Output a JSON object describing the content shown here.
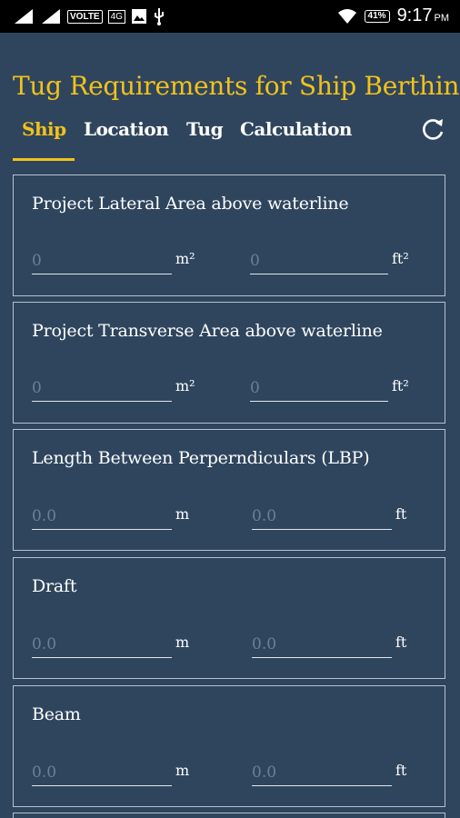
{
  "status_bar": {
    "volte": "VOLTE",
    "network": "4G",
    "battery": "41%",
    "time": "9:17",
    "ampm": "PM"
  },
  "app": {
    "title": "Tug Requirements for Ship Berthing"
  },
  "tabs": [
    {
      "label": "Ship",
      "active": true
    },
    {
      "label": "Location"
    },
    {
      "label": "Tug"
    },
    {
      "label": "Calculation"
    }
  ],
  "cards": [
    {
      "title": "Project Lateral Area above waterline",
      "left_placeholder": "0",
      "left_unit": "m²",
      "right_placeholder": "0",
      "right_unit": "ft²"
    },
    {
      "title": "Project Transverse Area above waterline",
      "left_placeholder": "0",
      "left_unit": "m²",
      "right_placeholder": "0",
      "right_unit": "ft²"
    },
    {
      "title": "Length Between Perperndiculars (LBP)",
      "left_placeholder": "0.0",
      "left_unit": "m",
      "right_placeholder": "0.0",
      "right_unit": "ft"
    },
    {
      "title": "Draft",
      "left_placeholder": "0.0",
      "left_unit": "m",
      "right_placeholder": "0.0",
      "right_unit": "ft"
    },
    {
      "title": "Beam",
      "left_placeholder": "0.0",
      "left_unit": "m",
      "right_placeholder": "0.0",
      "right_unit": "ft"
    }
  ],
  "icons": {
    "refresh": "refresh-icon"
  }
}
